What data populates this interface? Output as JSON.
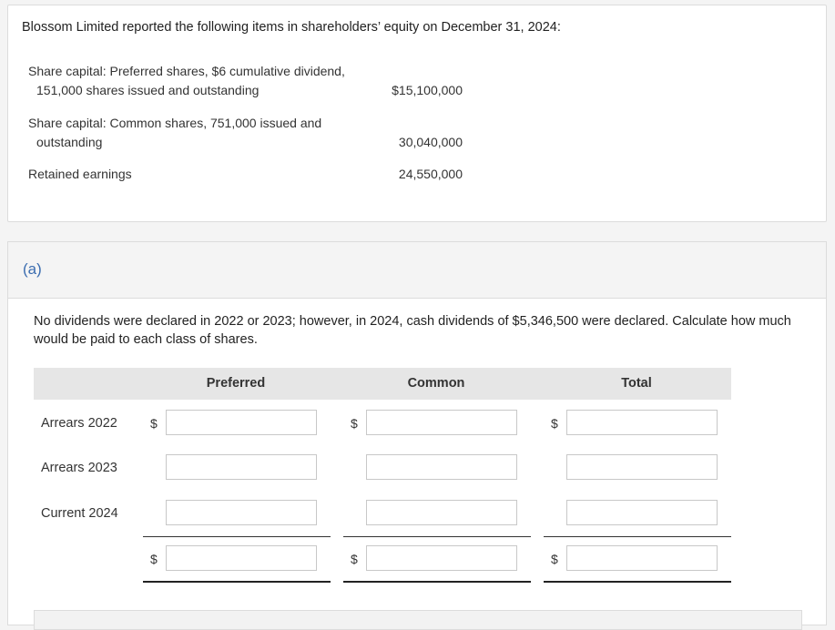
{
  "problem": {
    "intro": "Blossom Limited reported the following items in shareholders’ equity on December 31, 2024:",
    "items": [
      {
        "line1": "Share capital: Preferred shares, $6 cumulative dividend,",
        "line2": "151,000 shares issued and outstanding",
        "value": "$15,100,000"
      },
      {
        "line1": "Share capital: Common shares, 751,000 issued and",
        "line2": "outstanding",
        "value": "30,040,000"
      },
      {
        "line1": "Retained earnings",
        "line2": "",
        "value": "24,550,000"
      }
    ]
  },
  "part_a": {
    "label": "(a)",
    "question": "No dividends were declared in 2022 or 2023; however, in 2024, cash dividends of $5,346,500 were declared. Calculate how much would be paid to each class of shares.",
    "columns": [
      "Preferred",
      "Common",
      "Total"
    ],
    "rows": [
      "Arrears 2022",
      "Arrears 2023",
      "Current 2024"
    ],
    "currency": "$",
    "values": {
      "arrears_2022": {
        "preferred": "",
        "common": "",
        "total": ""
      },
      "arrears_2023": {
        "preferred": "",
        "common": "",
        "total": ""
      },
      "current_2024": {
        "preferred": "",
        "common": "",
        "total": ""
      },
      "total_row": {
        "preferred": "",
        "common": "",
        "total": ""
      }
    }
  }
}
